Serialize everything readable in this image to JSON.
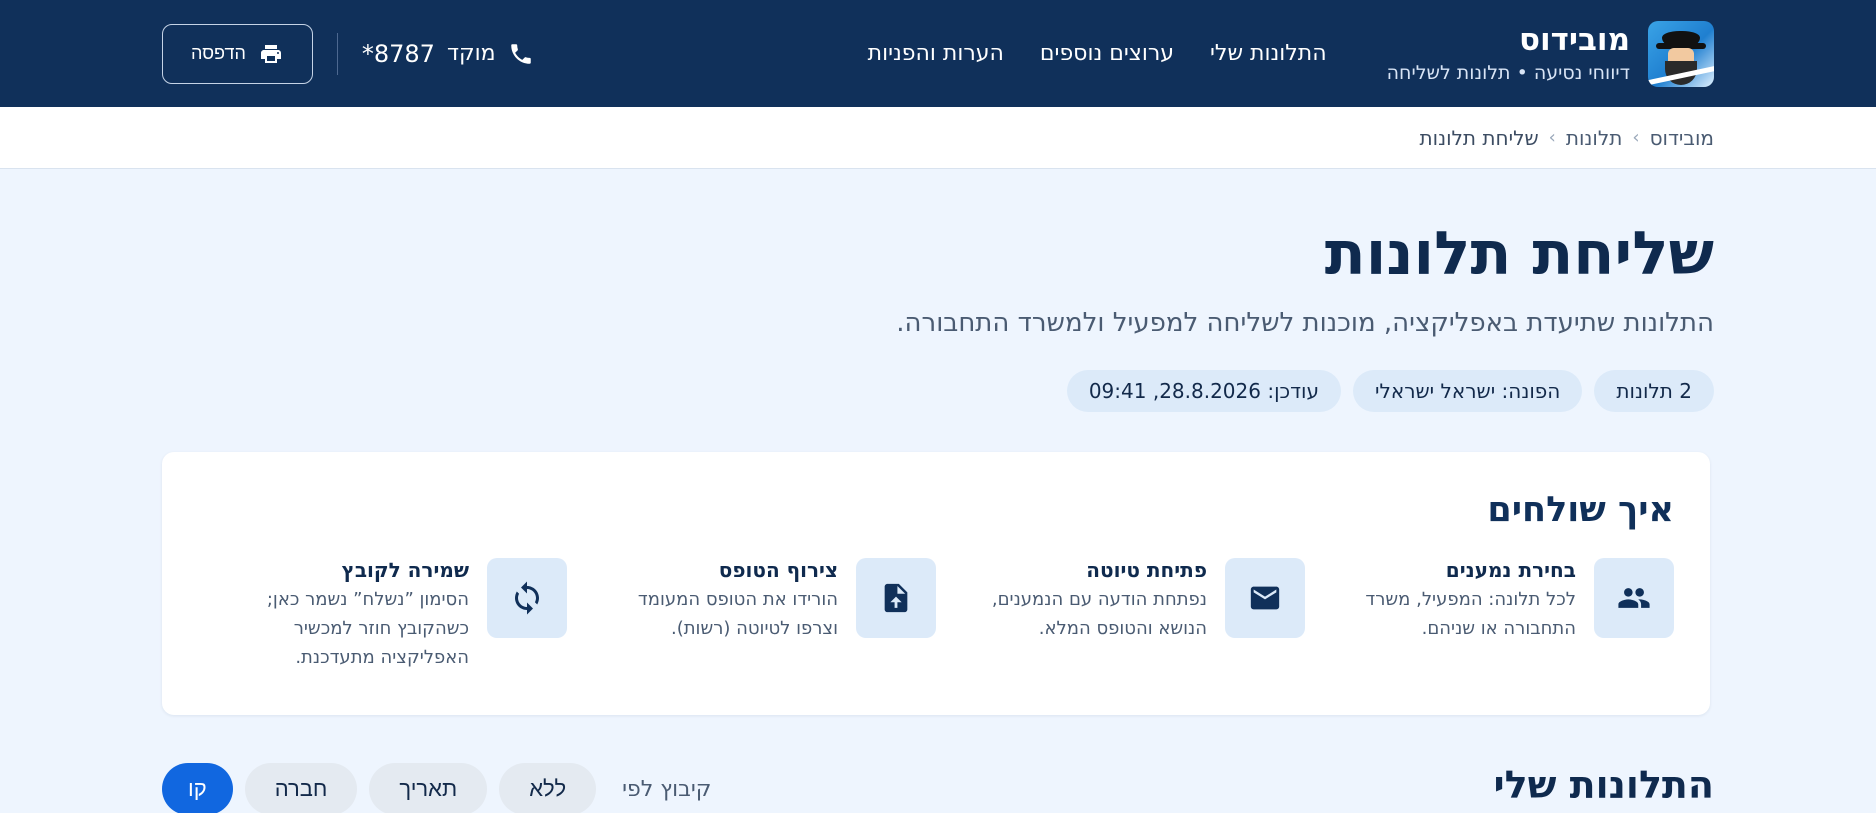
{
  "header": {
    "brand_name": "מובידוס",
    "brand_tagline": "דיווחי נסיעה • תלונות לשליחה",
    "nav": [
      {
        "label": "התלונות שלי"
      },
      {
        "label": "ערוצים נוספים"
      },
      {
        "label": "הערות והפניות"
      }
    ],
    "hotline_label": "מוקד",
    "hotline_number": "*8787",
    "print_label": "הדפסה"
  },
  "breadcrumb": {
    "items": [
      "מובידוס",
      "תלונות",
      "שליחת תלונות"
    ]
  },
  "page": {
    "title": "שליחת תלונות",
    "subtitle": "התלונות שתיעדת באפליקציה, מוכנות לשליחה למפעיל ולמשרד התחבורה.",
    "chips": [
      "2 תלונות",
      "הפונה: ישראל ישראלי",
      "עודכן: 28.8.2026, 09:41"
    ]
  },
  "how_to": {
    "title": "איך שולחים",
    "steps": [
      {
        "icon": "people-icon",
        "title": "בחירת נמענים",
        "desc": "לכל תלונה: המפעיל, משרד התחבורה או שניהם."
      },
      {
        "icon": "envelope-icon",
        "title": "פתיחת טיוטה",
        "desc": "נפתחת הודעה עם הנמענים, הנושא והטופס המלא."
      },
      {
        "icon": "file-upload-icon",
        "title": "צירוף הטופס",
        "desc": "הורידו את הטופס המעומד וצרפו לטיוטה (רשות)."
      },
      {
        "icon": "sync-icon",
        "title": "שמירה לקובץ",
        "desc": "הסימון ”נשלח” נשמר כאן; כשהקובץ חוזר למכשיר האפליקציה מתעדכנת."
      }
    ]
  },
  "my_complaints": {
    "title": "התלונות שלי",
    "group_by_label": "קיבוץ לפי",
    "group_options": [
      "ללא",
      "תאריך",
      "חברה",
      "קו"
    ],
    "active_option": "קו"
  },
  "colors": {
    "header_bg": "#10305a",
    "page_bg": "#eef5fe",
    "accent": "#1167e0",
    "chip_bg": "#dceaf9"
  }
}
